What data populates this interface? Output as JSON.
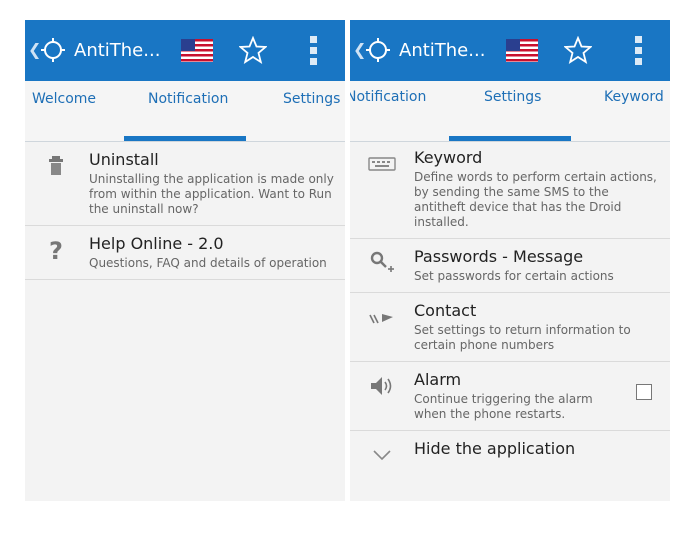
{
  "left": {
    "app_title": "AntiThe...",
    "tabs": [
      "Welcome",
      "Notification",
      "Settings"
    ],
    "items": [
      {
        "title": "Uninstall",
        "subtitle": "Uninstalling the application is made only from within the application. Want to Run the uninstall now?",
        "icon": "trash-icon"
      },
      {
        "title": "Help Online - 2.0",
        "subtitle": "Questions, FAQ and details of operation",
        "icon": "question-icon"
      }
    ]
  },
  "right": {
    "app_title": "AntiThe...",
    "tabs": [
      "Notification",
      "Settings",
      "Keyword"
    ],
    "items": [
      {
        "title": "Keyword",
        "subtitle": "Define words to perform certain actions, by sending the same SMS to the antitheft device that has the Droid installed.",
        "icon": "keyboard-icon"
      },
      {
        "title": "Passwords - Message",
        "subtitle": "Set passwords for certain actions",
        "icon": "key-icon"
      },
      {
        "title": "Contact",
        "subtitle": "Set settings to return information to certain phone numbers",
        "icon": "forward-icon"
      },
      {
        "title": "Alarm",
        "subtitle": "Continue triggering the alarm when the phone restarts.",
        "icon": "speaker-icon"
      },
      {
        "title": "Hide the application",
        "subtitle": "",
        "icon": "chevron-down-icon"
      }
    ]
  },
  "colors": {
    "accent": "#1976c4",
    "tab_text": "#1e6fb6",
    "background": "#f3f3f3"
  }
}
